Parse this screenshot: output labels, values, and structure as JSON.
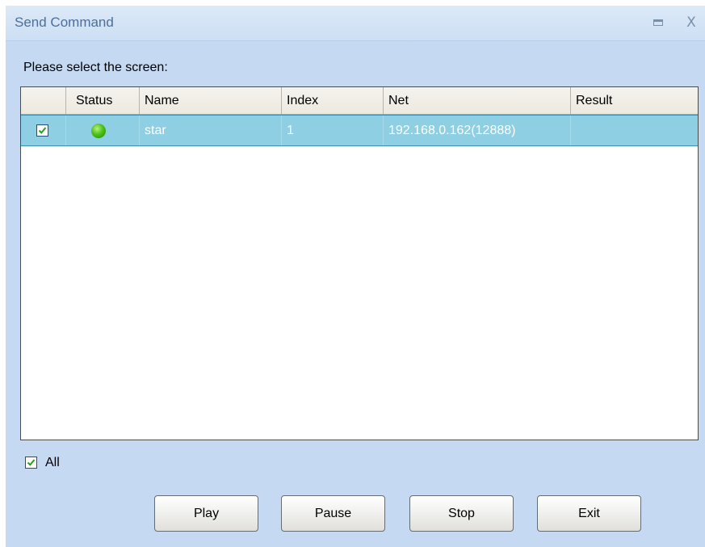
{
  "window": {
    "title": "Send Command",
    "minimize_icon": "window-minimize-icon",
    "close_glyph": "X"
  },
  "prompt": "Please select the screen:",
  "table": {
    "columns": [
      "",
      "Status",
      "Name",
      "Index",
      "Net",
      "Result"
    ],
    "rows": [
      {
        "checked": true,
        "status": "online",
        "status_color": "#4cc21a",
        "name": "star",
        "index": "1",
        "net": "192.168.0.162(12888)",
        "result": ""
      }
    ]
  },
  "select_all": {
    "label": "All",
    "checked": true
  },
  "buttons": {
    "play": "Play",
    "pause": "Pause",
    "stop": "Stop",
    "exit": "Exit"
  },
  "colors": {
    "window_bg": "#c5d9f2",
    "selected_row": "#8ecfe3",
    "title_text": "#4d6f99"
  }
}
